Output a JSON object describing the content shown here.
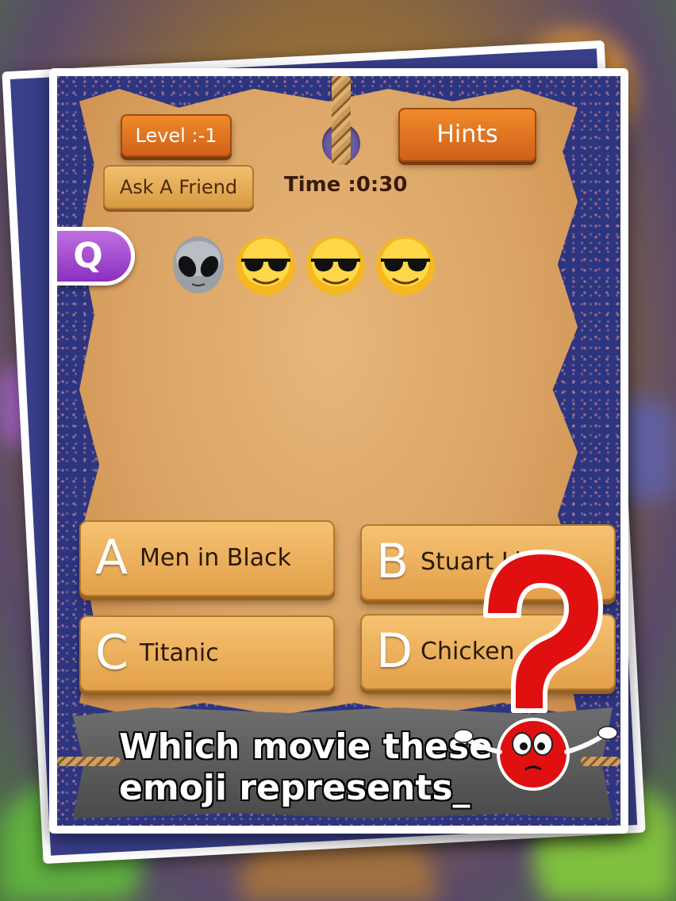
{
  "game": {
    "level_label": "Level :-1",
    "hints_label": "Hints",
    "ask_friend_label": "Ask A Friend",
    "time_label": "Time :0:30",
    "question_badge": "Q",
    "question_emojis": [
      "alien-icon",
      "sunglasses-face-icon",
      "sunglasses-face-icon",
      "sunglasses-face-icon"
    ],
    "prompt": "Which movie these emoji represents_",
    "answers": [
      {
        "letter": "A",
        "text": "Men in Black"
      },
      {
        "letter": "B",
        "text": "Stuart Little"
      },
      {
        "letter": "C",
        "text": "Titanic"
      },
      {
        "letter": "D",
        "text": "Chicken"
      }
    ]
  },
  "colors": {
    "wood_button": "#e07020",
    "parchment": "#d9a262",
    "frame_blue": "#2d3580",
    "question_pill": "#a040d0",
    "mascot_red": "#e01010"
  }
}
